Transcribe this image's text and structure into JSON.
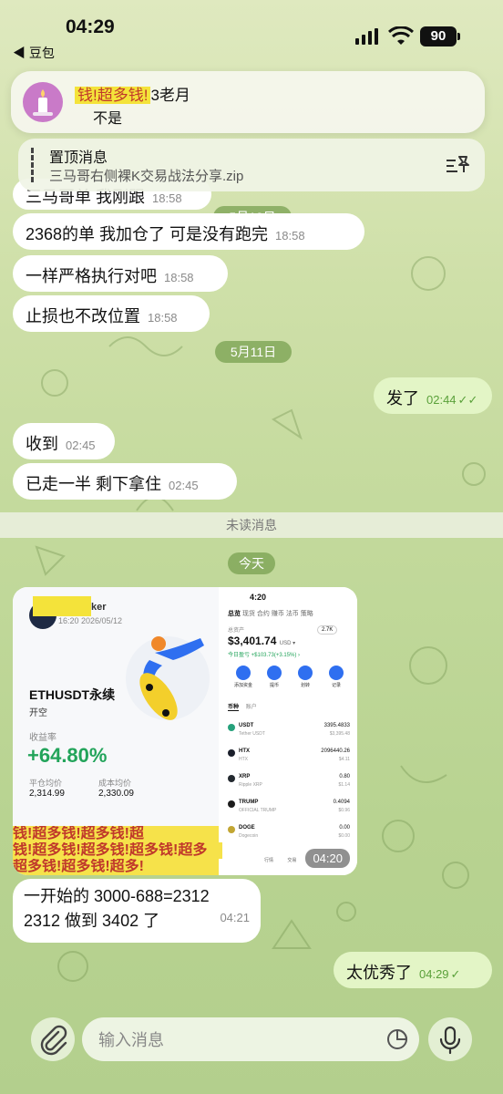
{
  "status_bar": {
    "time": "04:29",
    "battery": "90",
    "back_app": "◀ 豆包"
  },
  "notification": {
    "sender_masked": "钱!超多钱!",
    "sender_suffix": "3老月",
    "message": "不是"
  },
  "pinned": {
    "title": "置顶消息",
    "subtitle": "三马哥右侧裸K交易战法分享.zip"
  },
  "date_pills": {
    "may10": "5月10日",
    "may11": "5月11日",
    "today": "今天"
  },
  "unread_label": "未读消息",
  "messages": [
    {
      "text": "三马哥单 我刚跟",
      "time": "18:58"
    },
    {
      "text": "2368的单 我加仓了 可是没有跑完",
      "time": "18:58"
    },
    {
      "text": "一样严格执行对吧",
      "time": "18:58"
    },
    {
      "text": "止损也不改位置",
      "time": "18:58"
    },
    {
      "text": "发了",
      "time": "02:44"
    },
    {
      "text": "收到",
      "time": "02:45"
    },
    {
      "text": "已走一半 剩下拿住",
      "time": "02:45"
    },
    {
      "text_line1": "一开始的 3000-688=2312",
      "text_line2": "2312 做到 3402 了",
      "time": "04:21"
    },
    {
      "text": "太优秀了",
      "time": "04:29"
    }
  ],
  "image": {
    "time": "04:20",
    "left": {
      "user_suffix": "ker",
      "user_time": "16:20 2026/05/12",
      "pair": "ETHUSDT永续",
      "side": "开空",
      "roi_label": "收益率",
      "roi_value": "+64.80%",
      "avg_open_label": "平仓均价",
      "avg_open_value": "2,314.99",
      "avg_cost_label": "成本均价",
      "avg_cost_value": "2,330.09",
      "banner1": "钱!超多钱!超多钱!超",
      "banner2": "钱!超多钱!超多钱!超多钱!超多",
      "banner3": "超多钱!超多钱!超多!"
    },
    "right": {
      "clock": "4:20",
      "tabs": [
        "总览",
        "现货",
        "合约",
        "赚币",
        "法币",
        "策略"
      ],
      "total_label": "总资产",
      "total_value": "$3,401.74",
      "total_unit": "USD ▾",
      "pnl": "今日盈亏 +$103.73(+3.15%) ›",
      "badge": "2.7K",
      "actions": [
        "添加资金",
        "提币",
        "划转",
        "记录"
      ],
      "list_tabs": [
        "币种",
        "账户"
      ],
      "coins": [
        {
          "sym": "USDT",
          "name": "Tether USDT",
          "amt": "3395.4833",
          "val": "$3,395.48",
          "color": "#26a17b"
        },
        {
          "sym": "HTX",
          "name": "HTX",
          "amt": "2096440.26",
          "val": "$4.11",
          "color": "#1b1f2b"
        },
        {
          "sym": "XRP",
          "name": "Ripple XRP",
          "amt": "0.80",
          "val": "$1.14",
          "color": "#23292f"
        },
        {
          "sym": "TRUMP",
          "name": "OFFICIAL TRUMP",
          "amt": "0.4094",
          "val": "$0.96",
          "color": "#1c1c1c"
        },
        {
          "sym": "DOGE",
          "name": "Dogecoin",
          "amt": "0.00",
          "val": "$0.00",
          "color": "#c2a633"
        }
      ],
      "nav": [
        "行情",
        "交易"
      ]
    }
  },
  "composer": {
    "placeholder": "输入消息"
  }
}
